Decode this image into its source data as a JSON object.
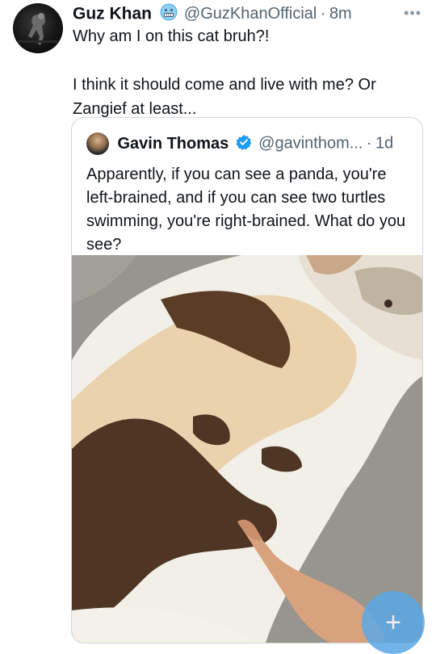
{
  "tweet": {
    "author_name": "Guz Khan",
    "author_handle": "@GuzKhanOfficial",
    "separator": "·",
    "time": "8m",
    "more_label": "•••",
    "text": "Why am I on this cat bruh?!\n\nI think it should come and live with me? Or Zangief at least..."
  },
  "quoted": {
    "author_name": "Gavin Thomas",
    "author_handle": "@gavinthom...",
    "separator": "·",
    "time": "1d",
    "text": "Apparently, if you can see a panda, you're left-brained, and if you can see two turtles swimming, you're right-brained. What do you see?"
  },
  "fab": {
    "label": "+"
  },
  "colors": {
    "accent": "#1d9bf0",
    "secondary_text": "#536471",
    "border": "#cfd9de",
    "fab": "#5aa8e6"
  },
  "icons": [
    "face-emoji-icon",
    "verified-badge-icon",
    "more-icon",
    "plus-icon"
  ]
}
